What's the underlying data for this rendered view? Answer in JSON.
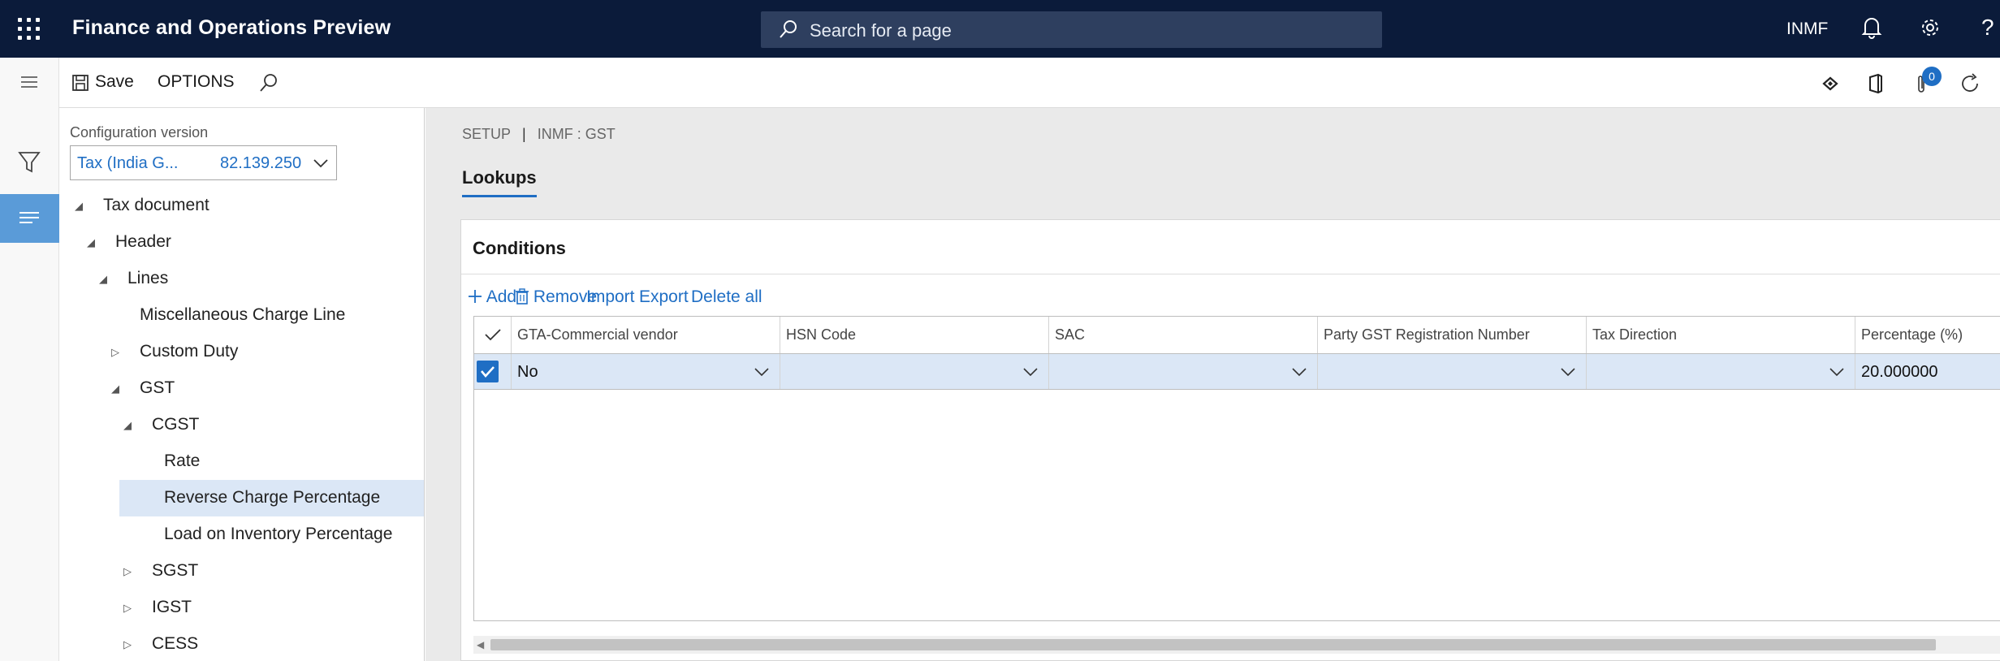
{
  "app": {
    "title": "Finance and Operations Preview",
    "search_placeholder": "Search for a page",
    "company": "INMF"
  },
  "actionbar": {
    "save_label": "Save",
    "options_label": "OPTIONS",
    "notification_count": "0"
  },
  "config": {
    "label": "Configuration version",
    "selected_name": "Tax (India G...",
    "selected_version": "82.139.250"
  },
  "tree": [
    {
      "label": "Tax document",
      "state": "expanded"
    },
    {
      "label": "Header",
      "state": "expanded"
    },
    {
      "label": "Lines",
      "state": "expanded"
    },
    {
      "label": "Miscellaneous Charge Line",
      "state": "leaf"
    },
    {
      "label": "Custom Duty",
      "state": "collapsed"
    },
    {
      "label": "GST",
      "state": "expanded"
    },
    {
      "label": "CGST",
      "state": "expanded"
    },
    {
      "label": "Rate",
      "state": "leaf"
    },
    {
      "label": "Reverse Charge Percentage",
      "state": "leaf",
      "selected": true
    },
    {
      "label": "Load on Inventory Percentage",
      "state": "leaf"
    },
    {
      "label": "SGST",
      "state": "collapsed"
    },
    {
      "label": "IGST",
      "state": "collapsed"
    },
    {
      "label": "CESS",
      "state": "collapsed"
    }
  ],
  "breadcrumb": {
    "part1": "SETUP",
    "separator": "|",
    "part2": "INMF : GST"
  },
  "tab": {
    "label": "Lookups"
  },
  "conditions": {
    "title": "Conditions",
    "toolbar": {
      "add": "Add",
      "remove": "Remove",
      "import": "Import",
      "export": "Export",
      "delete_all": "Delete all"
    },
    "columns": [
      "GTA-Commercial vendor",
      "HSN Code",
      "SAC",
      "Party GST Registration Number",
      "Tax Direction",
      "Percentage (%)"
    ],
    "rows": [
      {
        "selected": true,
        "cells": [
          "No",
          "",
          "",
          "",
          "",
          "20.000000"
        ]
      }
    ]
  },
  "colors": {
    "nav_bg": "#0b1b3a",
    "accent": "#1f6ec4",
    "selection": "#dbe7f6",
    "rail_active": "#5a9bd8"
  },
  "icons": {
    "waffle": "app-launcher-icon",
    "search": "search-icon",
    "bell": "bell-icon",
    "gear": "gear-icon",
    "help": "help-icon",
    "hamburger": "hamburger-icon",
    "filter": "filter-icon",
    "list": "list-icon",
    "save": "save-icon",
    "diamond": "diamond-icon",
    "office": "office-icon",
    "attach": "attachment-icon",
    "refresh": "refresh-icon"
  }
}
